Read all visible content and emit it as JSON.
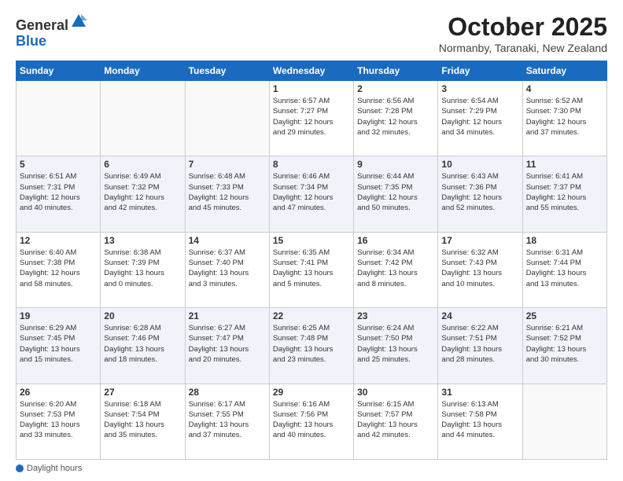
{
  "header": {
    "logo_general": "General",
    "logo_blue": "Blue",
    "month_title": "October 2025",
    "location": "Normanby, Taranaki, New Zealand"
  },
  "days_of_week": [
    "Sunday",
    "Monday",
    "Tuesday",
    "Wednesday",
    "Thursday",
    "Friday",
    "Saturday"
  ],
  "weeks": [
    [
      {
        "day": "",
        "info": ""
      },
      {
        "day": "",
        "info": ""
      },
      {
        "day": "",
        "info": ""
      },
      {
        "day": "1",
        "info": "Sunrise: 6:57 AM\nSunset: 7:27 PM\nDaylight: 12 hours\nand 29 minutes."
      },
      {
        "day": "2",
        "info": "Sunrise: 6:56 AM\nSunset: 7:28 PM\nDaylight: 12 hours\nand 32 minutes."
      },
      {
        "day": "3",
        "info": "Sunrise: 6:54 AM\nSunset: 7:29 PM\nDaylight: 12 hours\nand 34 minutes."
      },
      {
        "day": "4",
        "info": "Sunrise: 6:52 AM\nSunset: 7:30 PM\nDaylight: 12 hours\nand 37 minutes."
      }
    ],
    [
      {
        "day": "5",
        "info": "Sunrise: 6:51 AM\nSunset: 7:31 PM\nDaylight: 12 hours\nand 40 minutes."
      },
      {
        "day": "6",
        "info": "Sunrise: 6:49 AM\nSunset: 7:32 PM\nDaylight: 12 hours\nand 42 minutes."
      },
      {
        "day": "7",
        "info": "Sunrise: 6:48 AM\nSunset: 7:33 PM\nDaylight: 12 hours\nand 45 minutes."
      },
      {
        "day": "8",
        "info": "Sunrise: 6:46 AM\nSunset: 7:34 PM\nDaylight: 12 hours\nand 47 minutes."
      },
      {
        "day": "9",
        "info": "Sunrise: 6:44 AM\nSunset: 7:35 PM\nDaylight: 12 hours\nand 50 minutes."
      },
      {
        "day": "10",
        "info": "Sunrise: 6:43 AM\nSunset: 7:36 PM\nDaylight: 12 hours\nand 52 minutes."
      },
      {
        "day": "11",
        "info": "Sunrise: 6:41 AM\nSunset: 7:37 PM\nDaylight: 12 hours\nand 55 minutes."
      }
    ],
    [
      {
        "day": "12",
        "info": "Sunrise: 6:40 AM\nSunset: 7:38 PM\nDaylight: 12 hours\nand 58 minutes."
      },
      {
        "day": "13",
        "info": "Sunrise: 6:38 AM\nSunset: 7:39 PM\nDaylight: 13 hours\nand 0 minutes."
      },
      {
        "day": "14",
        "info": "Sunrise: 6:37 AM\nSunset: 7:40 PM\nDaylight: 13 hours\nand 3 minutes."
      },
      {
        "day": "15",
        "info": "Sunrise: 6:35 AM\nSunset: 7:41 PM\nDaylight: 13 hours\nand 5 minutes."
      },
      {
        "day": "16",
        "info": "Sunrise: 6:34 AM\nSunset: 7:42 PM\nDaylight: 13 hours\nand 8 minutes."
      },
      {
        "day": "17",
        "info": "Sunrise: 6:32 AM\nSunset: 7:43 PM\nDaylight: 13 hours\nand 10 minutes."
      },
      {
        "day": "18",
        "info": "Sunrise: 6:31 AM\nSunset: 7:44 PM\nDaylight: 13 hours\nand 13 minutes."
      }
    ],
    [
      {
        "day": "19",
        "info": "Sunrise: 6:29 AM\nSunset: 7:45 PM\nDaylight: 13 hours\nand 15 minutes."
      },
      {
        "day": "20",
        "info": "Sunrise: 6:28 AM\nSunset: 7:46 PM\nDaylight: 13 hours\nand 18 minutes."
      },
      {
        "day": "21",
        "info": "Sunrise: 6:27 AM\nSunset: 7:47 PM\nDaylight: 13 hours\nand 20 minutes."
      },
      {
        "day": "22",
        "info": "Sunrise: 6:25 AM\nSunset: 7:48 PM\nDaylight: 13 hours\nand 23 minutes."
      },
      {
        "day": "23",
        "info": "Sunrise: 6:24 AM\nSunset: 7:50 PM\nDaylight: 13 hours\nand 25 minutes."
      },
      {
        "day": "24",
        "info": "Sunrise: 6:22 AM\nSunset: 7:51 PM\nDaylight: 13 hours\nand 28 minutes."
      },
      {
        "day": "25",
        "info": "Sunrise: 6:21 AM\nSunset: 7:52 PM\nDaylight: 13 hours\nand 30 minutes."
      }
    ],
    [
      {
        "day": "26",
        "info": "Sunrise: 6:20 AM\nSunset: 7:53 PM\nDaylight: 13 hours\nand 33 minutes."
      },
      {
        "day": "27",
        "info": "Sunrise: 6:18 AM\nSunset: 7:54 PM\nDaylight: 13 hours\nand 35 minutes."
      },
      {
        "day": "28",
        "info": "Sunrise: 6:17 AM\nSunset: 7:55 PM\nDaylight: 13 hours\nand 37 minutes."
      },
      {
        "day": "29",
        "info": "Sunrise: 6:16 AM\nSunset: 7:56 PM\nDaylight: 13 hours\nand 40 minutes."
      },
      {
        "day": "30",
        "info": "Sunrise: 6:15 AM\nSunset: 7:57 PM\nDaylight: 13 hours\nand 42 minutes."
      },
      {
        "day": "31",
        "info": "Sunrise: 6:13 AM\nSunset: 7:58 PM\nDaylight: 13 hours\nand 44 minutes."
      },
      {
        "day": "",
        "info": ""
      }
    ]
  ],
  "footer": {
    "daylight_label": "Daylight hours"
  }
}
